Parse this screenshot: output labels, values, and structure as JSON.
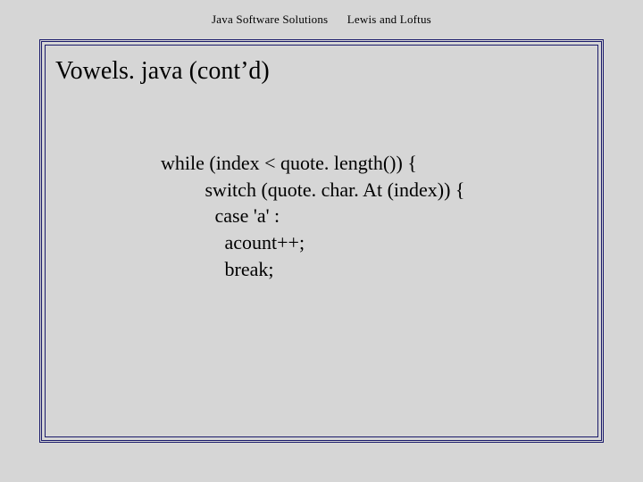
{
  "header": {
    "left": "Java Software Solutions",
    "right": "Lewis and Loftus"
  },
  "slide": {
    "title": "Vowels. java (cont’d)"
  },
  "code": {
    "lines": [
      "while (index < quote. length()) {",
      "         switch (quote. char. At (index)) {",
      "           case 'a' :",
      "             acount++;",
      "             break;"
    ]
  }
}
